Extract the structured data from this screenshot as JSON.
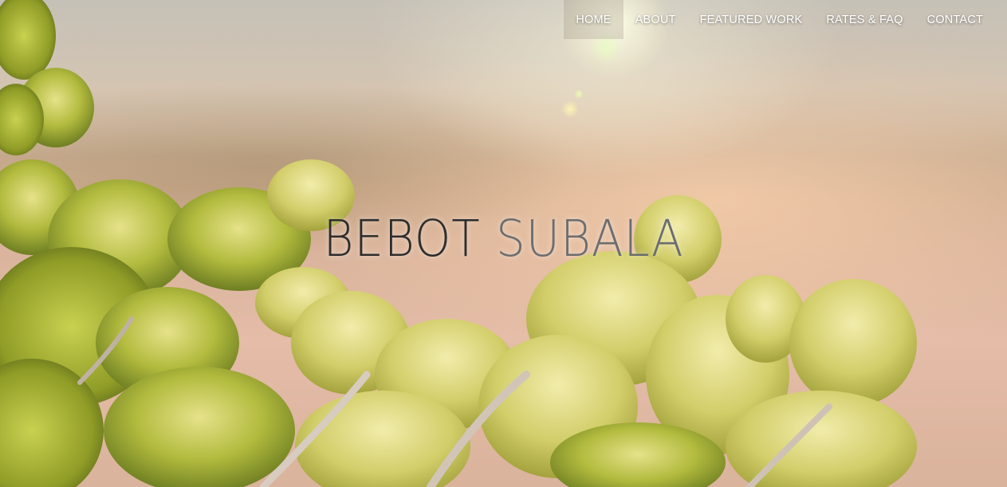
{
  "nav": {
    "items": [
      {
        "label": "HOME",
        "active": true
      },
      {
        "label": "ABOUT",
        "active": false
      },
      {
        "label": "FEATURED WORK",
        "active": false
      },
      {
        "label": "RATES & FAQ",
        "active": false
      },
      {
        "label": "CONTACT",
        "active": false
      }
    ]
  },
  "hero": {
    "title_first": "BEBOT",
    "title_last": "SUBALA"
  },
  "colors": {
    "title_first": "#2d2d2d",
    "title_last": "#6b6d70",
    "nav_text": "#ffffff",
    "foliage": "#a9b73a"
  }
}
